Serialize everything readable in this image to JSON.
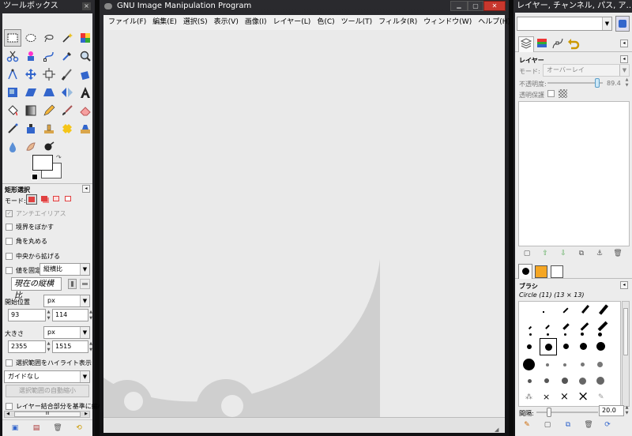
{
  "toolbox": {
    "title": "ツールボックス",
    "close": "×",
    "tool_options_title": "矩形選択",
    "mode_label": "モード:",
    "antialias": "アンチエイリアス",
    "feather": "境界をぼかす",
    "rounded": "角を丸める",
    "expand_center": "中央から拡げる",
    "fixed_label": "値を固定",
    "fixed_value": "縦横比",
    "ratio_text": "現在の縦横比",
    "position_label": "開始位置",
    "position_unit": "px",
    "pos_x": "93",
    "pos_y": "114",
    "size_label": "大きさ",
    "size_unit": "px",
    "size_w": "2355",
    "size_h": "1515",
    "highlight": "選択範囲をハイライト表示",
    "guides": "ガイドなし",
    "autoshrink": "選択範囲の自動縮小",
    "shrink_merged": "レイヤー結合部分を基準に縮小",
    "scroll_grip": "III"
  },
  "main": {
    "title": "GNU Image Manipulation Program",
    "menu": [
      "ファイル(F)",
      "編集(E)",
      "選択(S)",
      "表示(V)",
      "画像(I)",
      "レイヤー(L)",
      "色(C)",
      "ツール(T)",
      "フィルタ(R)",
      "ウィンドウ(W)",
      "ヘルプ(H)"
    ],
    "win_min": "▁",
    "win_max": "▢",
    "win_close": "✕"
  },
  "dock": {
    "title": "レイヤー, チャンネル, パス, ア…",
    "layers_title": "レイヤー",
    "mode_label": "モード:",
    "mode_value": "オーバーレイ",
    "opacity_label": "不透明度:",
    "opacity_value": "89.4",
    "opacity_fraction": 0.894,
    "lock_label": "透明保護",
    "brushes_title": "ブラシ",
    "brush_name": "Circle (11) (13 × 13)",
    "spacing_label": "間隔:",
    "spacing_value": "20.0",
    "spacing_fraction": 0.2
  },
  "colors": {
    "accent_red": "#e04040",
    "frame": "#1a1a1c",
    "panel": "#ececec"
  }
}
